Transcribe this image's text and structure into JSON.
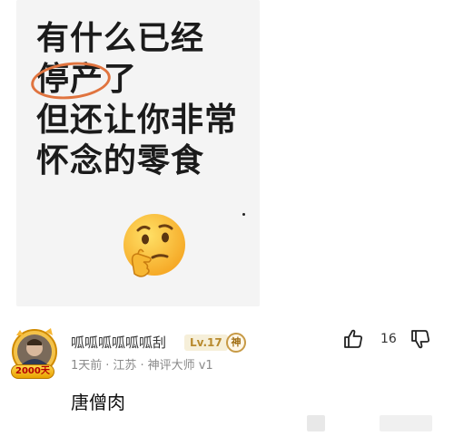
{
  "post": {
    "headline_lines": [
      "有什么已经",
      "停产",
      "了",
      "但还让你非常",
      "怀念的零食"
    ],
    "emoji": "thinking-face-icon"
  },
  "comment": {
    "username": "呱呱呱呱呱呱刮",
    "level": "Lv.17",
    "god_badge": "神",
    "avatar_badge": "2000天",
    "meta": {
      "time": "1天前",
      "location": "江苏",
      "title": "神评大师 v1",
      "separator": "·"
    },
    "text": "唐僧肉",
    "like_count": "16"
  },
  "colors": {
    "circle": "#e0743f",
    "level_text": "#b88a2e",
    "level_bg": "#f6efd9"
  }
}
